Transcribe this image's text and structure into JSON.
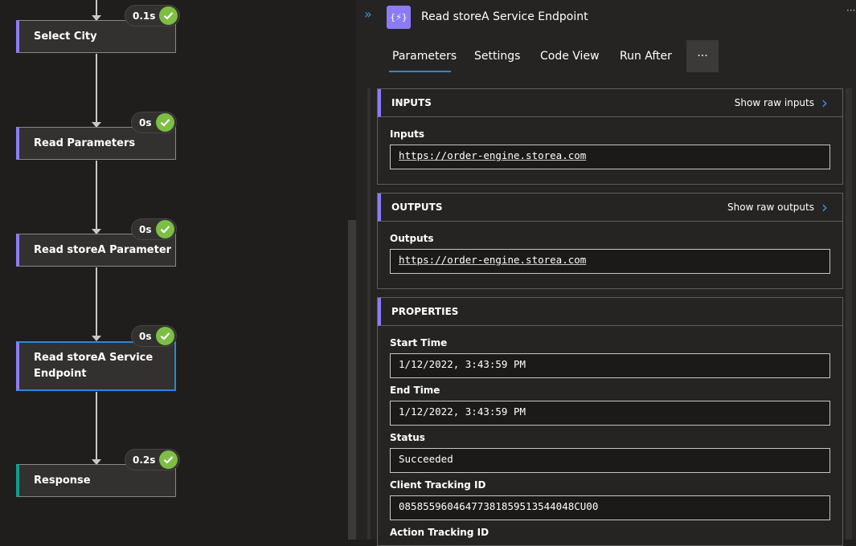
{
  "workflow": {
    "steps": [
      {
        "label": "Select City",
        "duration": "0.1s"
      },
      {
        "label": "Read Parameters",
        "duration": "0s"
      },
      {
        "label": "Read storeA Parameter",
        "duration": "0s"
      },
      {
        "label": "Read storeA Service Endpoint",
        "duration": "0s"
      },
      {
        "label": "Response",
        "duration": "0.2s"
      }
    ]
  },
  "panel": {
    "title": "Read storeA Service Endpoint",
    "icon": "{⚡}",
    "more": "···",
    "tabs": [
      "Parameters",
      "Settings",
      "Code View",
      "Run After"
    ],
    "tab_more": "···"
  },
  "inputs": {
    "header": "INPUTS",
    "raw_link": "Show raw inputs",
    "field_label": "Inputs",
    "value": "https://order-engine.storea.com"
  },
  "outputs": {
    "header": "OUTPUTS",
    "raw_link": "Show raw outputs",
    "field_label": "Outputs",
    "value": "https://order-engine.storea.com"
  },
  "properties": {
    "header": "PROPERTIES",
    "start_time_label": "Start Time",
    "start_time": "1/12/2022, 3:43:59 PM",
    "end_time_label": "End Time",
    "end_time": "1/12/2022, 3:43:59 PM",
    "status_label": "Status",
    "status": "Succeeded",
    "client_tracking_label": "Client Tracking ID",
    "client_tracking": "08585596046477381859513544048CU00",
    "action_tracking_label": "Action Tracking ID"
  },
  "colors": {
    "accent": "#8b7cf6",
    "success": "#7dbe44",
    "link": "#3a96dd",
    "selected": "#2b88d8"
  }
}
